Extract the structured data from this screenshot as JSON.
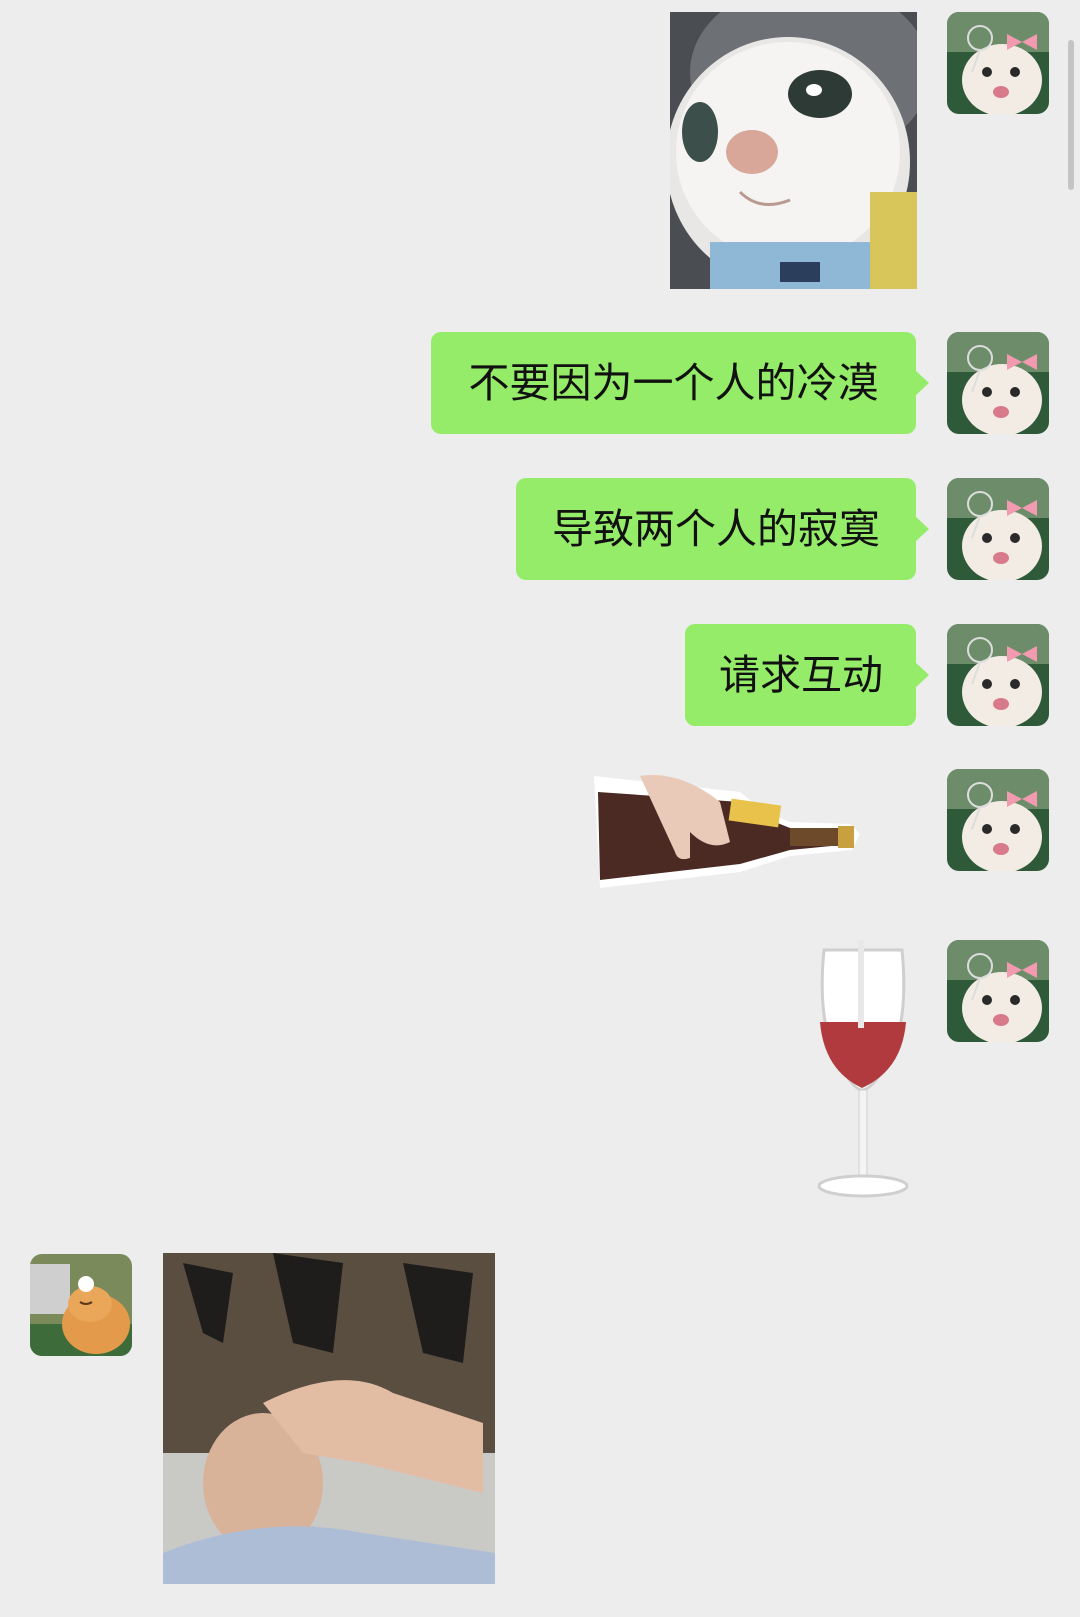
{
  "chat": {
    "messages": [
      {
        "side": "right",
        "type": "sticker",
        "sticker": "white-cat-closeup"
      },
      {
        "side": "right",
        "type": "text",
        "text": "不要因为一个人的冷漠"
      },
      {
        "side": "right",
        "type": "text",
        "text": "导致两个人的寂寞"
      },
      {
        "side": "right",
        "type": "text",
        "text": "请求互动"
      },
      {
        "side": "right",
        "type": "sticker",
        "sticker": "wine-bottle-pouring"
      },
      {
        "side": "right",
        "type": "sticker",
        "sticker": "wine-glass-filling"
      },
      {
        "side": "left",
        "type": "sticker",
        "sticker": "man-drinking-photo"
      }
    ]
  },
  "colors": {
    "background": "#ededed",
    "self_bubble": "#95ec69",
    "text": "#111111"
  },
  "icons": {
    "self_avatar": "white-cat-with-pink-bow-badminton",
    "other_avatar": "orange-cat-with-shuttlecock"
  }
}
